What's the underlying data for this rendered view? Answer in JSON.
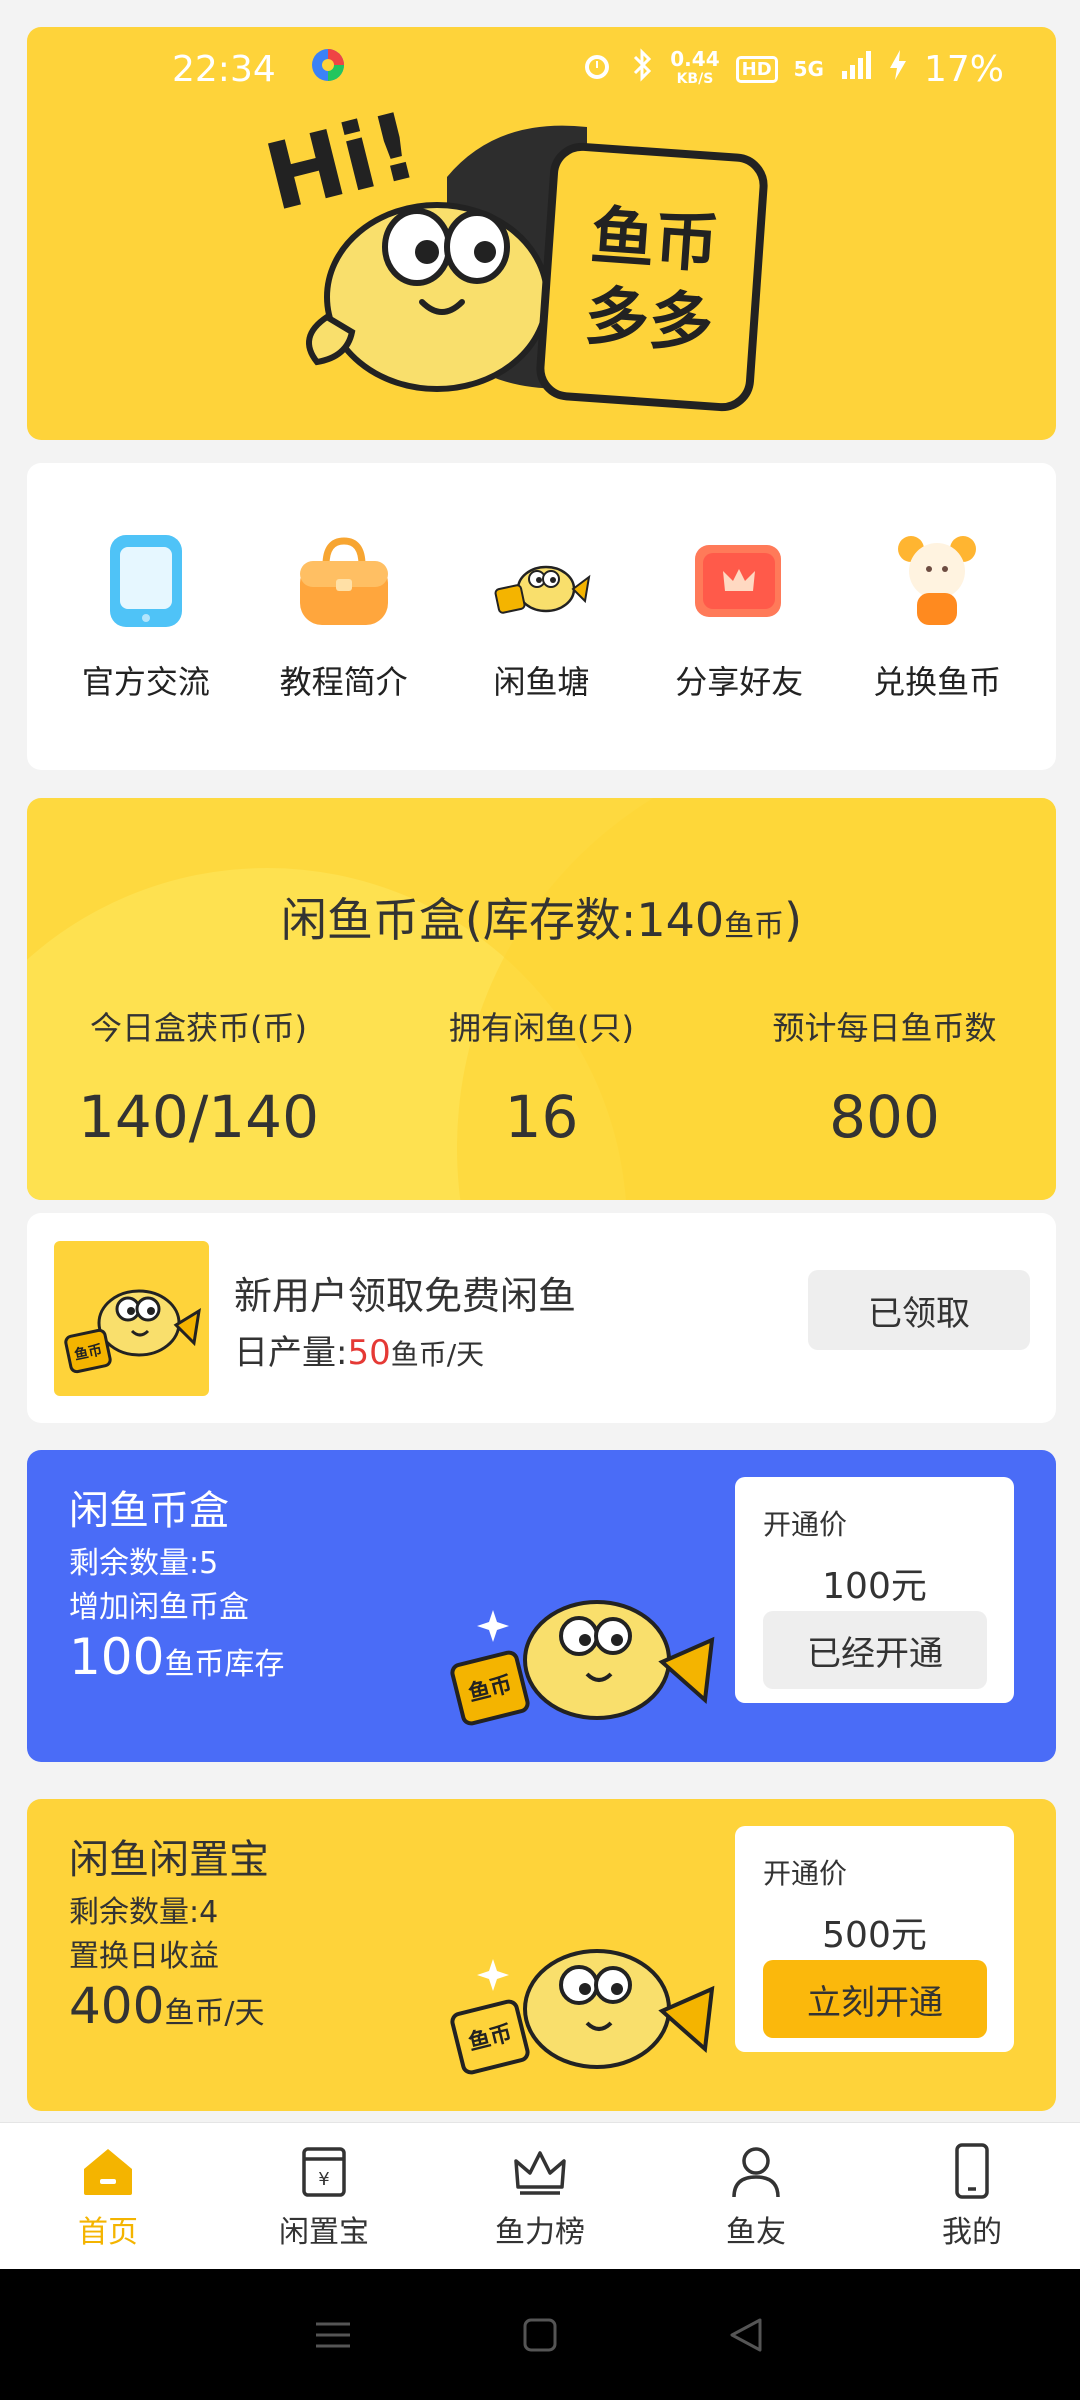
{
  "status_bar": {
    "time": "22:34",
    "net_speed_value": "0.44",
    "net_speed_unit": "KB/S",
    "hd": "HD",
    "network": "5G",
    "battery": "17%"
  },
  "menu": [
    {
      "label": "官方交流",
      "icon": "tablet-icon"
    },
    {
      "label": "教程简介",
      "icon": "bag-icon"
    },
    {
      "label": "闲鱼塘",
      "icon": "fish-mascot-icon"
    },
    {
      "label": "分享好友",
      "icon": "crown-card-icon"
    },
    {
      "label": "兑换鱼币",
      "icon": "bear-icon"
    }
  ],
  "coinbox": {
    "title_prefix": "闲鱼币盒(库存数:140",
    "title_unit": "鱼币",
    "title_suffix": ")",
    "stats": [
      {
        "label": "今日盒获币(币)",
        "value": "140/140"
      },
      {
        "label": "拥有闲鱼(只)",
        "value": "16"
      },
      {
        "label": "预计每日鱼币数",
        "value": "800"
      }
    ]
  },
  "free_fish": {
    "title": "新用户领取免费闲鱼",
    "sub_prefix": "日产量:",
    "sub_value": "50",
    "sub_unit": "鱼币/天",
    "button": "已领取"
  },
  "offers": [
    {
      "title": "闲鱼币盒",
      "line1": "剩余数量:5",
      "line2": "增加闲鱼币盒",
      "big_value": "100",
      "big_unit": "鱼币库存",
      "price_label": "开通价",
      "price": "100元",
      "button": "已经开通"
    },
    {
      "title": "闲鱼闲置宝",
      "line1": "剩余数量:4",
      "line2": "置换日收益",
      "big_value": "400",
      "big_unit": "鱼币/天",
      "price_label": "开通价",
      "price": "500元",
      "button": "立刻开通"
    }
  ],
  "bottom_nav": [
    {
      "label": "首页",
      "active": true
    },
    {
      "label": "闲置宝",
      "active": false
    },
    {
      "label": "鱼力榜",
      "active": false
    },
    {
      "label": "鱼友",
      "active": false
    },
    {
      "label": "我的",
      "active": false
    }
  ],
  "mascot_sign": "鱼币多多",
  "mascot_hi": "Hi!",
  "coin_badge": "鱼币",
  "colors": {
    "brand_yellow": "#fed33a",
    "offer_blue": "#4a6cf7",
    "active_nav": "#f4b400",
    "button_orange": "#fbb80c",
    "highlight_red": "#e53935"
  }
}
